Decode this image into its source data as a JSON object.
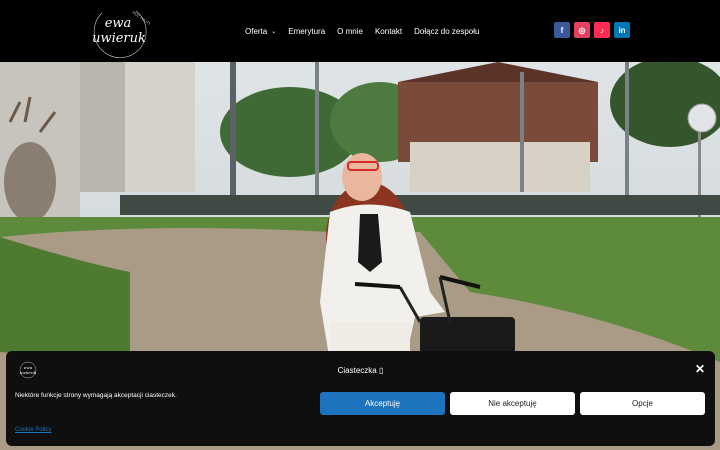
{
  "header": {
    "logo_text_top": "ewa",
    "logo_text_bottom": "uwieruk",
    "logo_tagline": "MOC POLITY"
  },
  "nav": {
    "items": [
      {
        "label": "Oferta",
        "has_dropdown": true
      },
      {
        "label": "Emerytura"
      },
      {
        "label": "O mnie"
      },
      {
        "label": "Kontakt"
      },
      {
        "label": "Dołącz do zespołu"
      }
    ]
  },
  "socials": [
    {
      "name": "facebook-icon",
      "glyph": "f",
      "color": "#3b5998"
    },
    {
      "name": "instagram-icon",
      "glyph": "◎",
      "color": "#e4405f"
    },
    {
      "name": "tiktok-icon",
      "glyph": "♪",
      "color": "#fe2c55"
    },
    {
      "name": "linkedin-icon",
      "glyph": "in",
      "color": "#0077b5"
    }
  ],
  "cookie": {
    "title": "Ciasteczka ▯",
    "message": "Niektóre funkcje strony wymagają akceptacji ciasteczek.",
    "accept_label": "Akceptuję",
    "deny_label": "Nie akceptuję",
    "options_label": "Opcje",
    "policy_link": "Cookie Policy",
    "close_glyph": "✕",
    "accent": "#1e73be"
  }
}
